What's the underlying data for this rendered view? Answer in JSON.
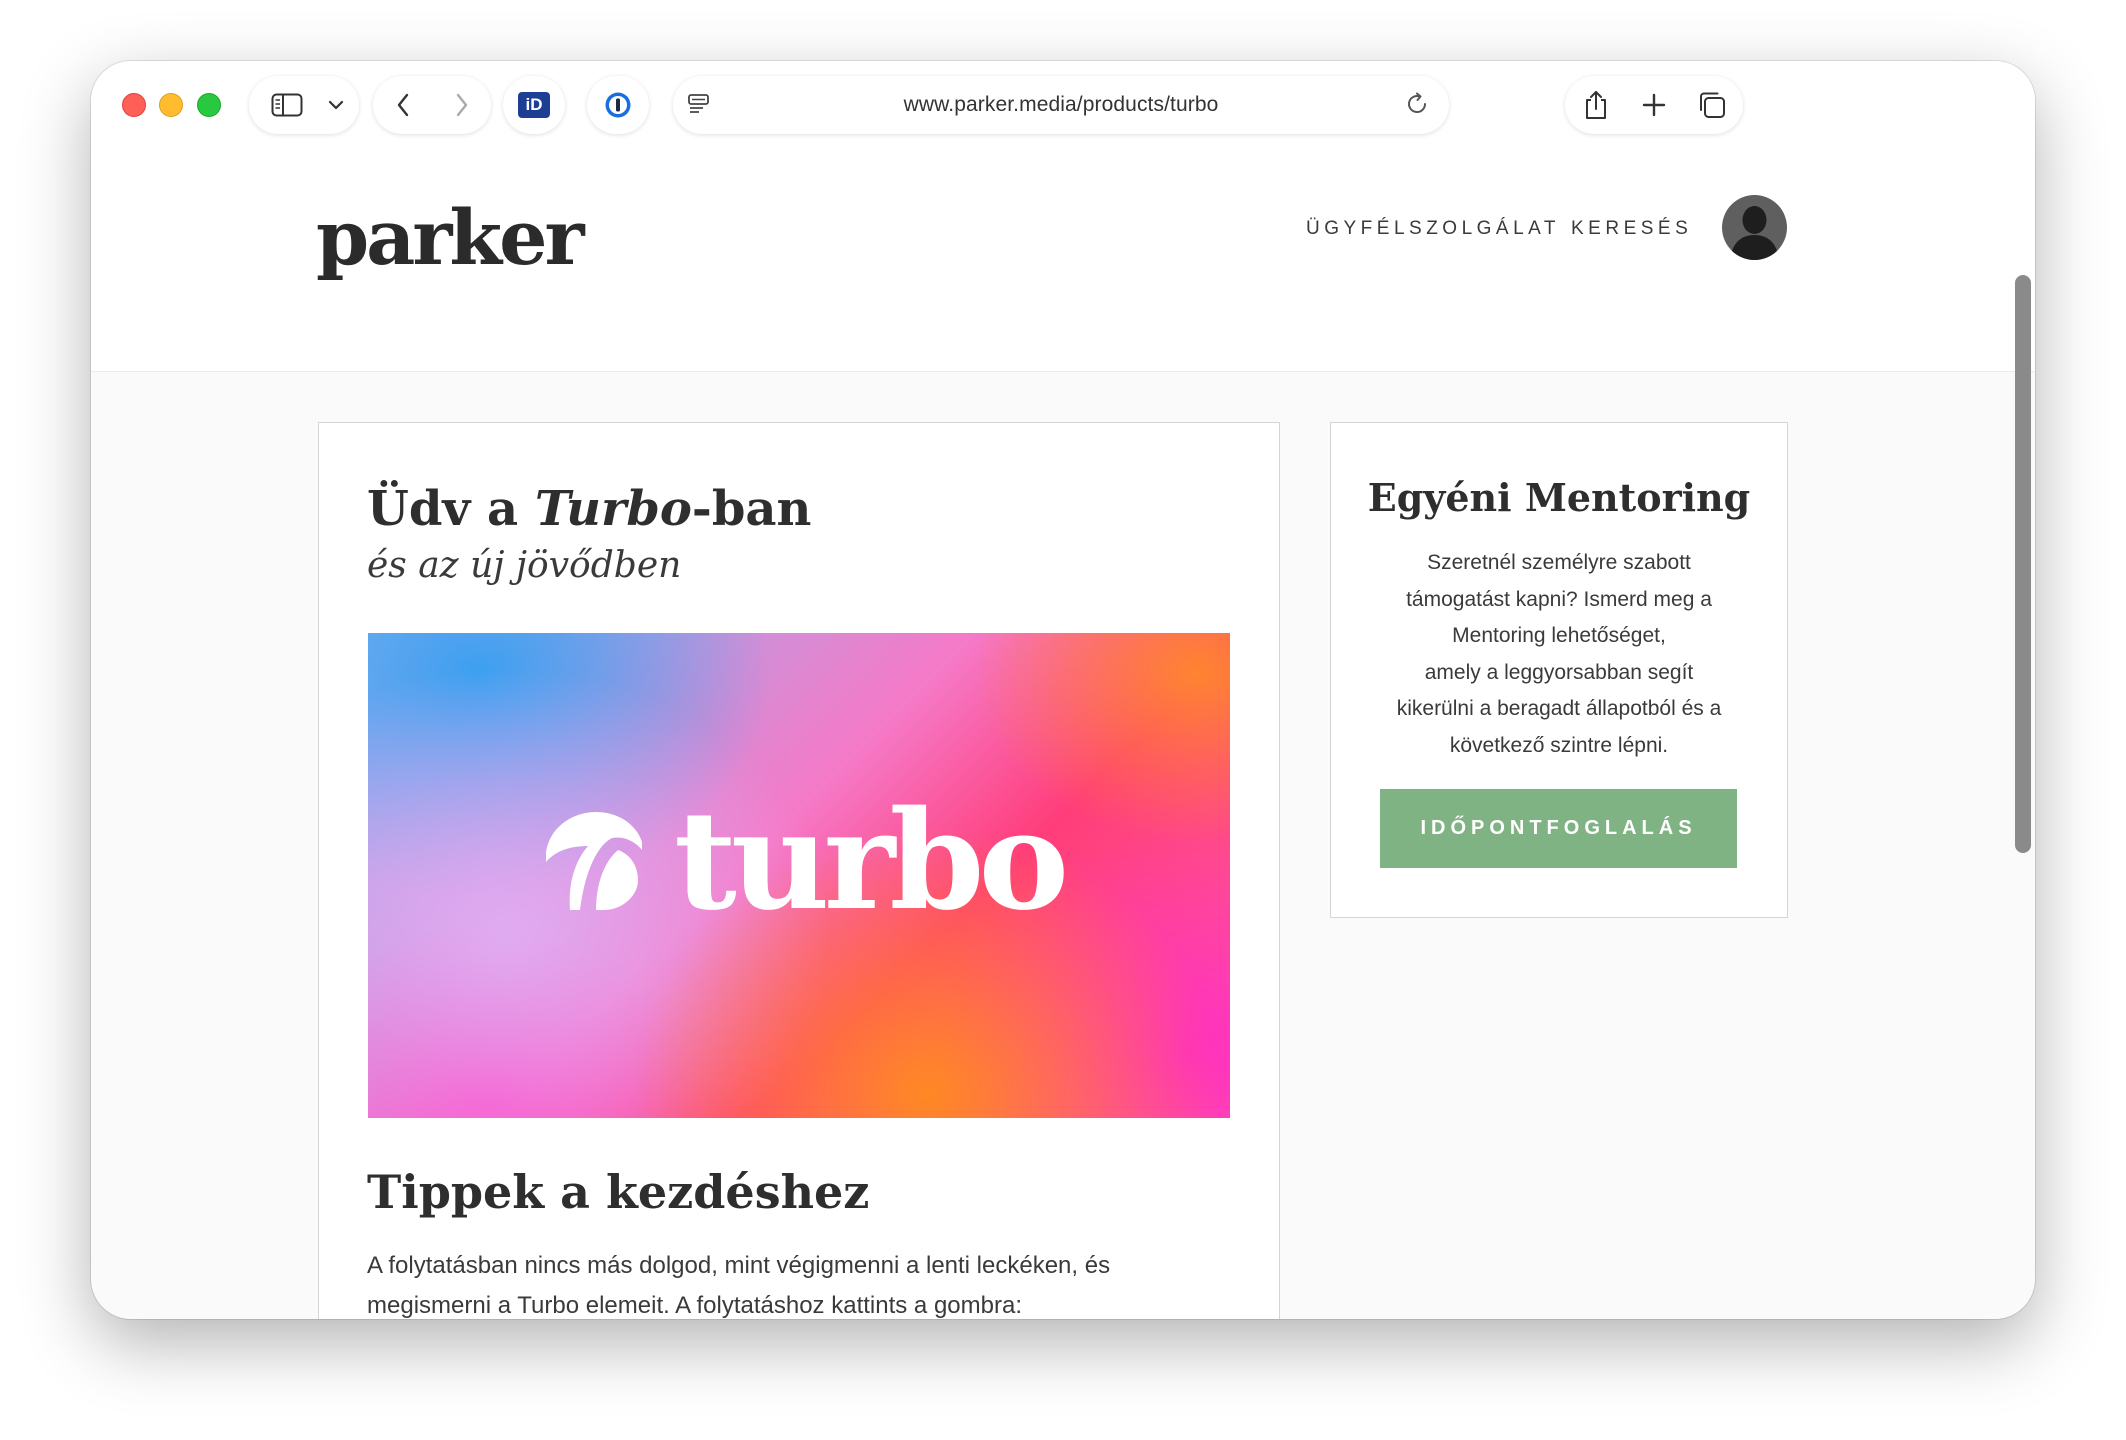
{
  "browser": {
    "url": "www.parker.media/products/turbo",
    "id_extension_label": "iD"
  },
  "site": {
    "logo": "parker",
    "nav": {
      "support": "ÜGYFÉLSZOLGÁLAT",
      "search": "KERESÉS"
    }
  },
  "main": {
    "title_prefix": "Üdv a ",
    "title_em": "Turbo",
    "title_suffix": "-ban",
    "subtitle": "és az új jövődben",
    "hero_word": "turbo",
    "tips_title": "Tippek a kezdéshez",
    "tips_line1": "A folytatásban nincs más dolgod, mint végigmenni a lenti leckéken, és",
    "tips_line2": "megismerni a Turbo elemeit. A folytatáshoz kattints a gombra:"
  },
  "sidebar": {
    "title": "Egyéni Mentoring",
    "lines": [
      "Szeretnél személyre szabott",
      "támogatást kapni? Ismerd meg a",
      "Mentoring lehetőséget,",
      "amely a leggyorsabban segít",
      "kikerülni a beragadt állapotból és a",
      "következő szintre lépni."
    ],
    "button": "IDŐPONTFOGLALÁS"
  },
  "colors": {
    "accent_green": "#80b383",
    "text_dark": "#2e2e2e"
  },
  "icons": [
    "sidebar-icon",
    "chevron-down-icon",
    "back-icon",
    "forward-icon",
    "1password-icon",
    "reader-icon",
    "reload-icon",
    "share-icon",
    "plus-icon",
    "tabs-icon",
    "chat-icon"
  ]
}
